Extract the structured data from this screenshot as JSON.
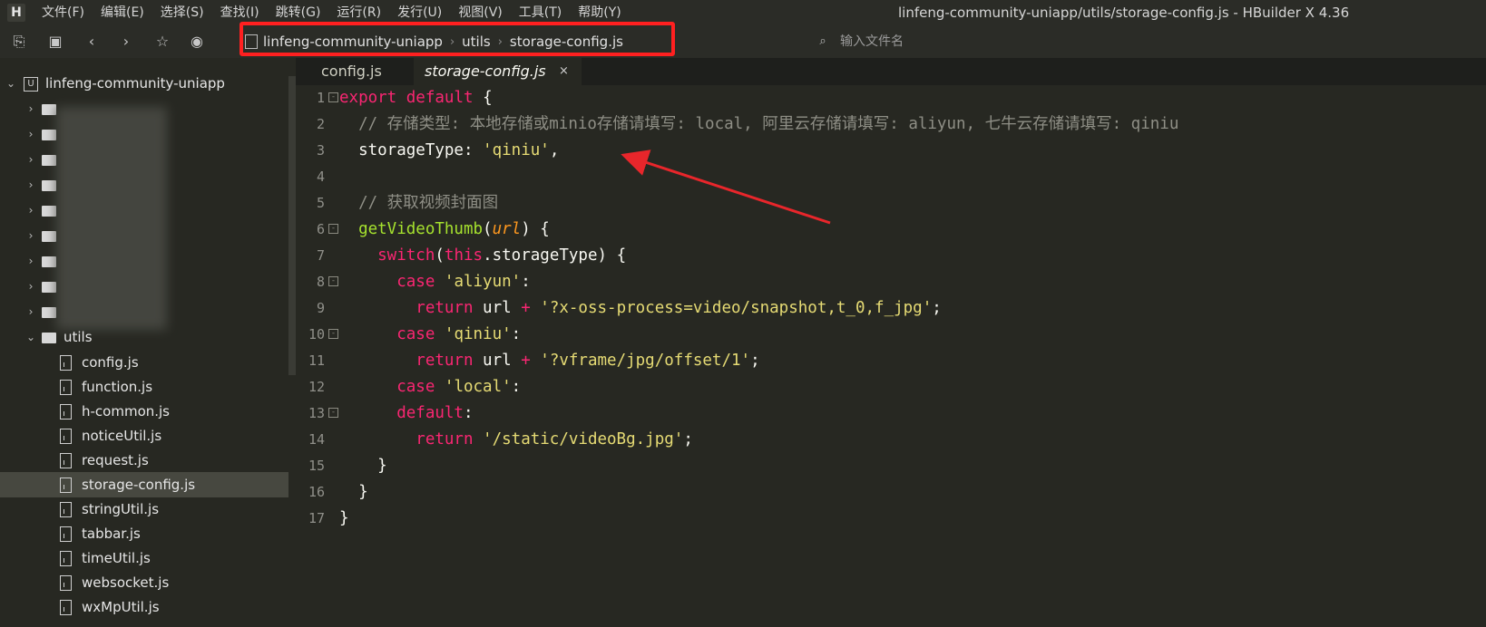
{
  "app": {
    "window_title": "linfeng-community-uniapp/utils/storage-config.js - HBuilder X 4.36",
    "logo_letter": "H"
  },
  "menu": [
    "文件(F)",
    "编辑(E)",
    "选择(S)",
    "查找(I)",
    "跳转(G)",
    "运行(R)",
    "发行(U)",
    "视图(V)",
    "工具(T)",
    "帮助(Y)"
  ],
  "toolbar": {
    "icons": [
      "new-file-icon",
      "save-icon",
      "back-icon",
      "forward-icon",
      "star-icon",
      "run-icon"
    ]
  },
  "breadcrumb": [
    "linfeng-community-uniapp",
    "utils",
    "storage-config.js"
  ],
  "search": {
    "placeholder": "输入文件名"
  },
  "sidebar": {
    "project": "linfeng-community-uniapp",
    "folder": "utils",
    "files": [
      "config.js",
      "function.js",
      "h-common.js",
      "noticeUtil.js",
      "request.js",
      "storage-config.js",
      "stringUtil.js",
      "tabbar.js",
      "timeUtil.js",
      "websocket.js",
      "wxMpUtil.js"
    ],
    "selected_file": "storage-config.js"
  },
  "tabs": [
    {
      "label": "config.js",
      "active": false
    },
    {
      "label": "storage-config.js",
      "active": true,
      "close": "×"
    }
  ],
  "editor": {
    "line_numbers": [
      "1",
      "2",
      "3",
      "4",
      "5",
      "6",
      "7",
      "8",
      "9",
      "10",
      "11",
      "12",
      "13",
      "14",
      "15",
      "16",
      "17"
    ],
    "lines": [
      [
        [
          "k",
          "export "
        ],
        [
          "k",
          "default "
        ],
        [
          "",
          "{"
        ]
      ],
      [
        [
          "c",
          "  // 存储类型: 本地存储或minio存储请填写: local, 阿里云存储请填写: aliyun, 七牛云存储请填写: qiniu"
        ]
      ],
      [
        [
          "",
          "  storageType: "
        ],
        [
          "s",
          "'qiniu'"
        ],
        [
          "",
          ","
        ]
      ],
      [],
      [
        [
          "c",
          "  // 获取视频封面图"
        ]
      ],
      [
        [
          "f",
          "  getVideoThumb"
        ],
        [
          "",
          "("
        ],
        [
          "p",
          "url"
        ],
        [
          "",
          ") {"
        ]
      ],
      [
        [
          "k",
          "    switch"
        ],
        [
          "",
          "("
        ],
        [
          "k",
          "this"
        ],
        [
          "",
          ".storageType) {"
        ]
      ],
      [
        [
          "k",
          "      case "
        ],
        [
          "s",
          "'aliyun'"
        ],
        [
          "",
          ":"
        ]
      ],
      [
        [
          "k",
          "        return "
        ],
        [
          "",
          "url "
        ],
        [
          "k",
          "+ "
        ],
        [
          "s",
          "'?x-oss-process=video/snapshot,t_0,f_jpg'"
        ],
        [
          "",
          ";"
        ]
      ],
      [
        [
          "k",
          "      case "
        ],
        [
          "s",
          "'qiniu'"
        ],
        [
          "",
          ":"
        ]
      ],
      [
        [
          "k",
          "        return "
        ],
        [
          "",
          "url "
        ],
        [
          "k",
          "+ "
        ],
        [
          "s",
          "'?vframe/jpg/offset/1'"
        ],
        [
          "",
          ";"
        ]
      ],
      [
        [
          "k",
          "      case "
        ],
        [
          "s",
          "'local'"
        ],
        [
          "",
          ":"
        ]
      ],
      [
        [
          "k",
          "      default"
        ],
        [
          "",
          ":"
        ]
      ],
      [
        [
          "k",
          "        return "
        ],
        [
          "s",
          "'/static/videoBg.jpg'"
        ],
        [
          "",
          ";"
        ]
      ],
      [
        [
          "",
          "    }"
        ]
      ],
      [
        [
          "",
          "  }"
        ]
      ],
      [
        [
          "",
          "}"
        ]
      ]
    ],
    "fold_markers": {
      "1": "⊟",
      "6": "⊟",
      "8": "⊟",
      "10": "⊟",
      "13": "⊟"
    }
  },
  "colors": {
    "highlight": "#ff2020",
    "arrow": "#e8262b",
    "editor_bg": "#272822"
  }
}
